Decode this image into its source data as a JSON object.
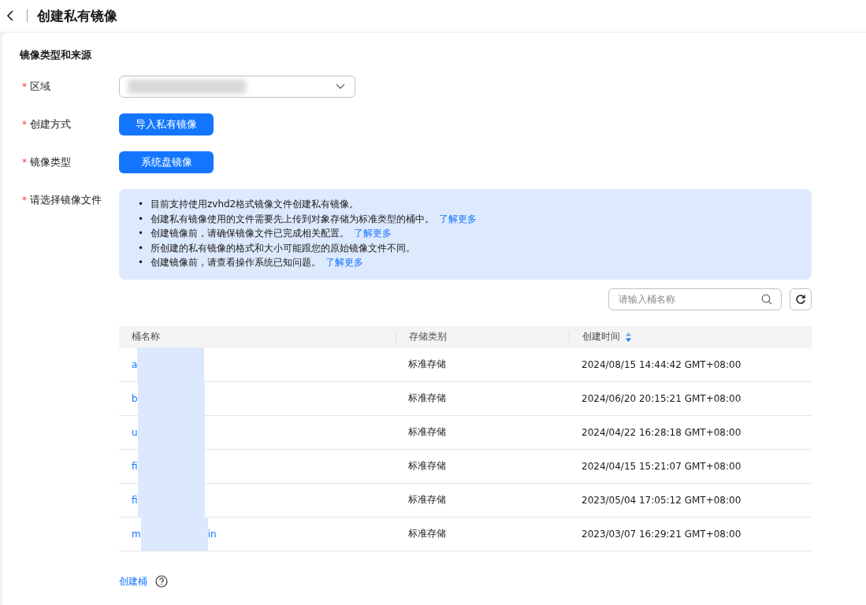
{
  "header": {
    "title": "创建私有镜像"
  },
  "section": {
    "title": "镜像类型和来源"
  },
  "form": [
    {
      "marker": "*",
      "label": "区域",
      "kind": "select"
    },
    {
      "marker": "*",
      "label": "创建方式",
      "kind": "button",
      "value": "导入私有镜像"
    },
    {
      "marker": "*",
      "label": "镜像类型",
      "kind": "button",
      "value": "系统盘镜像"
    },
    {
      "marker": "*",
      "label": "请选择镜像文件",
      "kind": "files"
    }
  ],
  "notice": [
    {
      "bullet": "•",
      "text": "目前支持使用zvhd2格式镜像文件创建私有镜像。"
    },
    {
      "bullet": "•",
      "text": "创建私有镜像使用的文件需要先上传到对象存储为标准类型的桶中。",
      "link": "了解更多"
    },
    {
      "bullet": "•",
      "text": "创建镜像前，请确保镜像文件已完成相关配置。",
      "link": "了解更多"
    },
    {
      "bullet": "•",
      "text": "所创建的私有镜像的格式和大小可能跟您的原始镜像文件不同。"
    },
    {
      "bullet": "•",
      "text": "创建镜像前，请查看操作系统已知问题。",
      "link": "了解更多"
    }
  ],
  "search": {
    "placeholder": "请输入桶名称"
  },
  "table": {
    "columns": [
      "桶名称",
      "存储类别",
      "创建时间"
    ],
    "rows": [
      {
        "name_start": "a",
        "storage": "标准存储",
        "created": "2024/08/15 14:44:42 GMT+08:00"
      },
      {
        "name_start": "b",
        "storage": "标准存储",
        "created": "2024/06/20 20:15:21 GMT+08:00"
      },
      {
        "name_start": "u",
        "storage": "标准存储",
        "created": "2024/04/22 16:28:18 GMT+08:00"
      },
      {
        "name_start": "fi",
        "storage": "标准存储",
        "created": "2024/04/15 15:21:07 GMT+08:00"
      },
      {
        "name_start": "fi",
        "storage": "标准存储",
        "created": "2023/05/04 17:05:12 GMT+08:00"
      },
      {
        "name_start": "m",
        "name_end": "in",
        "storage": "标准存储",
        "created": "2023/03/07 16:29:21 GMT+08:00"
      }
    ]
  },
  "footer": {
    "link": "创建桶"
  }
}
